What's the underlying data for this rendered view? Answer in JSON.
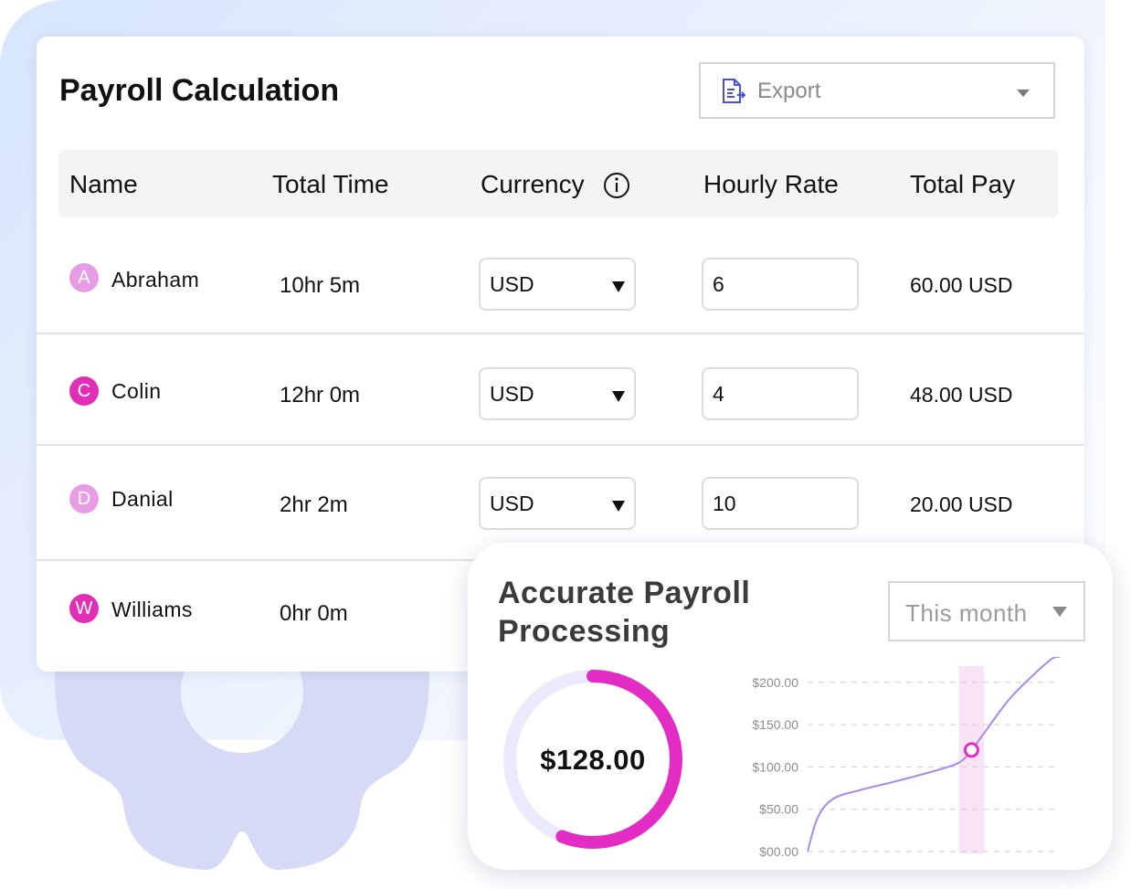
{
  "payroll": {
    "title": "Payroll Calculation",
    "export": {
      "label": "Export",
      "icon": "document-export-icon"
    },
    "columns": [
      "Name",
      "Total Time",
      "Currency",
      "Hourly Rate",
      "Total Pay"
    ],
    "rows": [
      {
        "initial": "A",
        "name": "Abraham",
        "avatar_color": "#e79de6",
        "time": "10hr 5m",
        "currency": "USD",
        "rate": "6",
        "pay": "60.00 USD"
      },
      {
        "initial": "C",
        "name": "Colin",
        "avatar_color": "#e02fb6",
        "time": "12hr 0m",
        "currency": "USD",
        "rate": "4",
        "pay": "48.00 USD"
      },
      {
        "initial": "D",
        "name": "Danial",
        "avatar_color": "#e79de6",
        "time": "2hr 2m",
        "currency": "USD",
        "rate": "10",
        "pay": "20.00 USD"
      },
      {
        "initial": "W",
        "name": "Williams",
        "avatar_color": "#e02fb6",
        "time": "0hr 0m"
      }
    ]
  },
  "summary": {
    "title_line1": "Accurate Payroll",
    "title_line2": "Processing",
    "period": "This month",
    "total": "$128.00",
    "progress_fraction": 0.56,
    "accent_color": "#e22cc3",
    "track_color": "#ede9fd"
  },
  "chart_data": {
    "type": "line",
    "y_ticks": [
      "$00.00",
      "$50.00",
      "$100.00",
      "$150.00",
      "$200.00"
    ],
    "ylim": [
      0,
      230
    ],
    "xlim": [
      0,
      1
    ],
    "grid": true,
    "line_color": "#a78bea",
    "x": [
      0,
      0.04,
      0.1,
      0.2,
      0.35,
      0.5,
      0.6,
      0.65,
      0.7,
      0.8,
      0.9,
      0.97,
      1.0
    ],
    "values": [
      0,
      40,
      62,
      72,
      83,
      95,
      105,
      120,
      140,
      180,
      210,
      228,
      230
    ],
    "highlight": {
      "x": 0.65,
      "value": 120,
      "band": [
        0.6,
        0.7
      ]
    }
  },
  "colors": {
    "gear": "#d7daf7",
    "background_blob": "#e3edfe"
  }
}
